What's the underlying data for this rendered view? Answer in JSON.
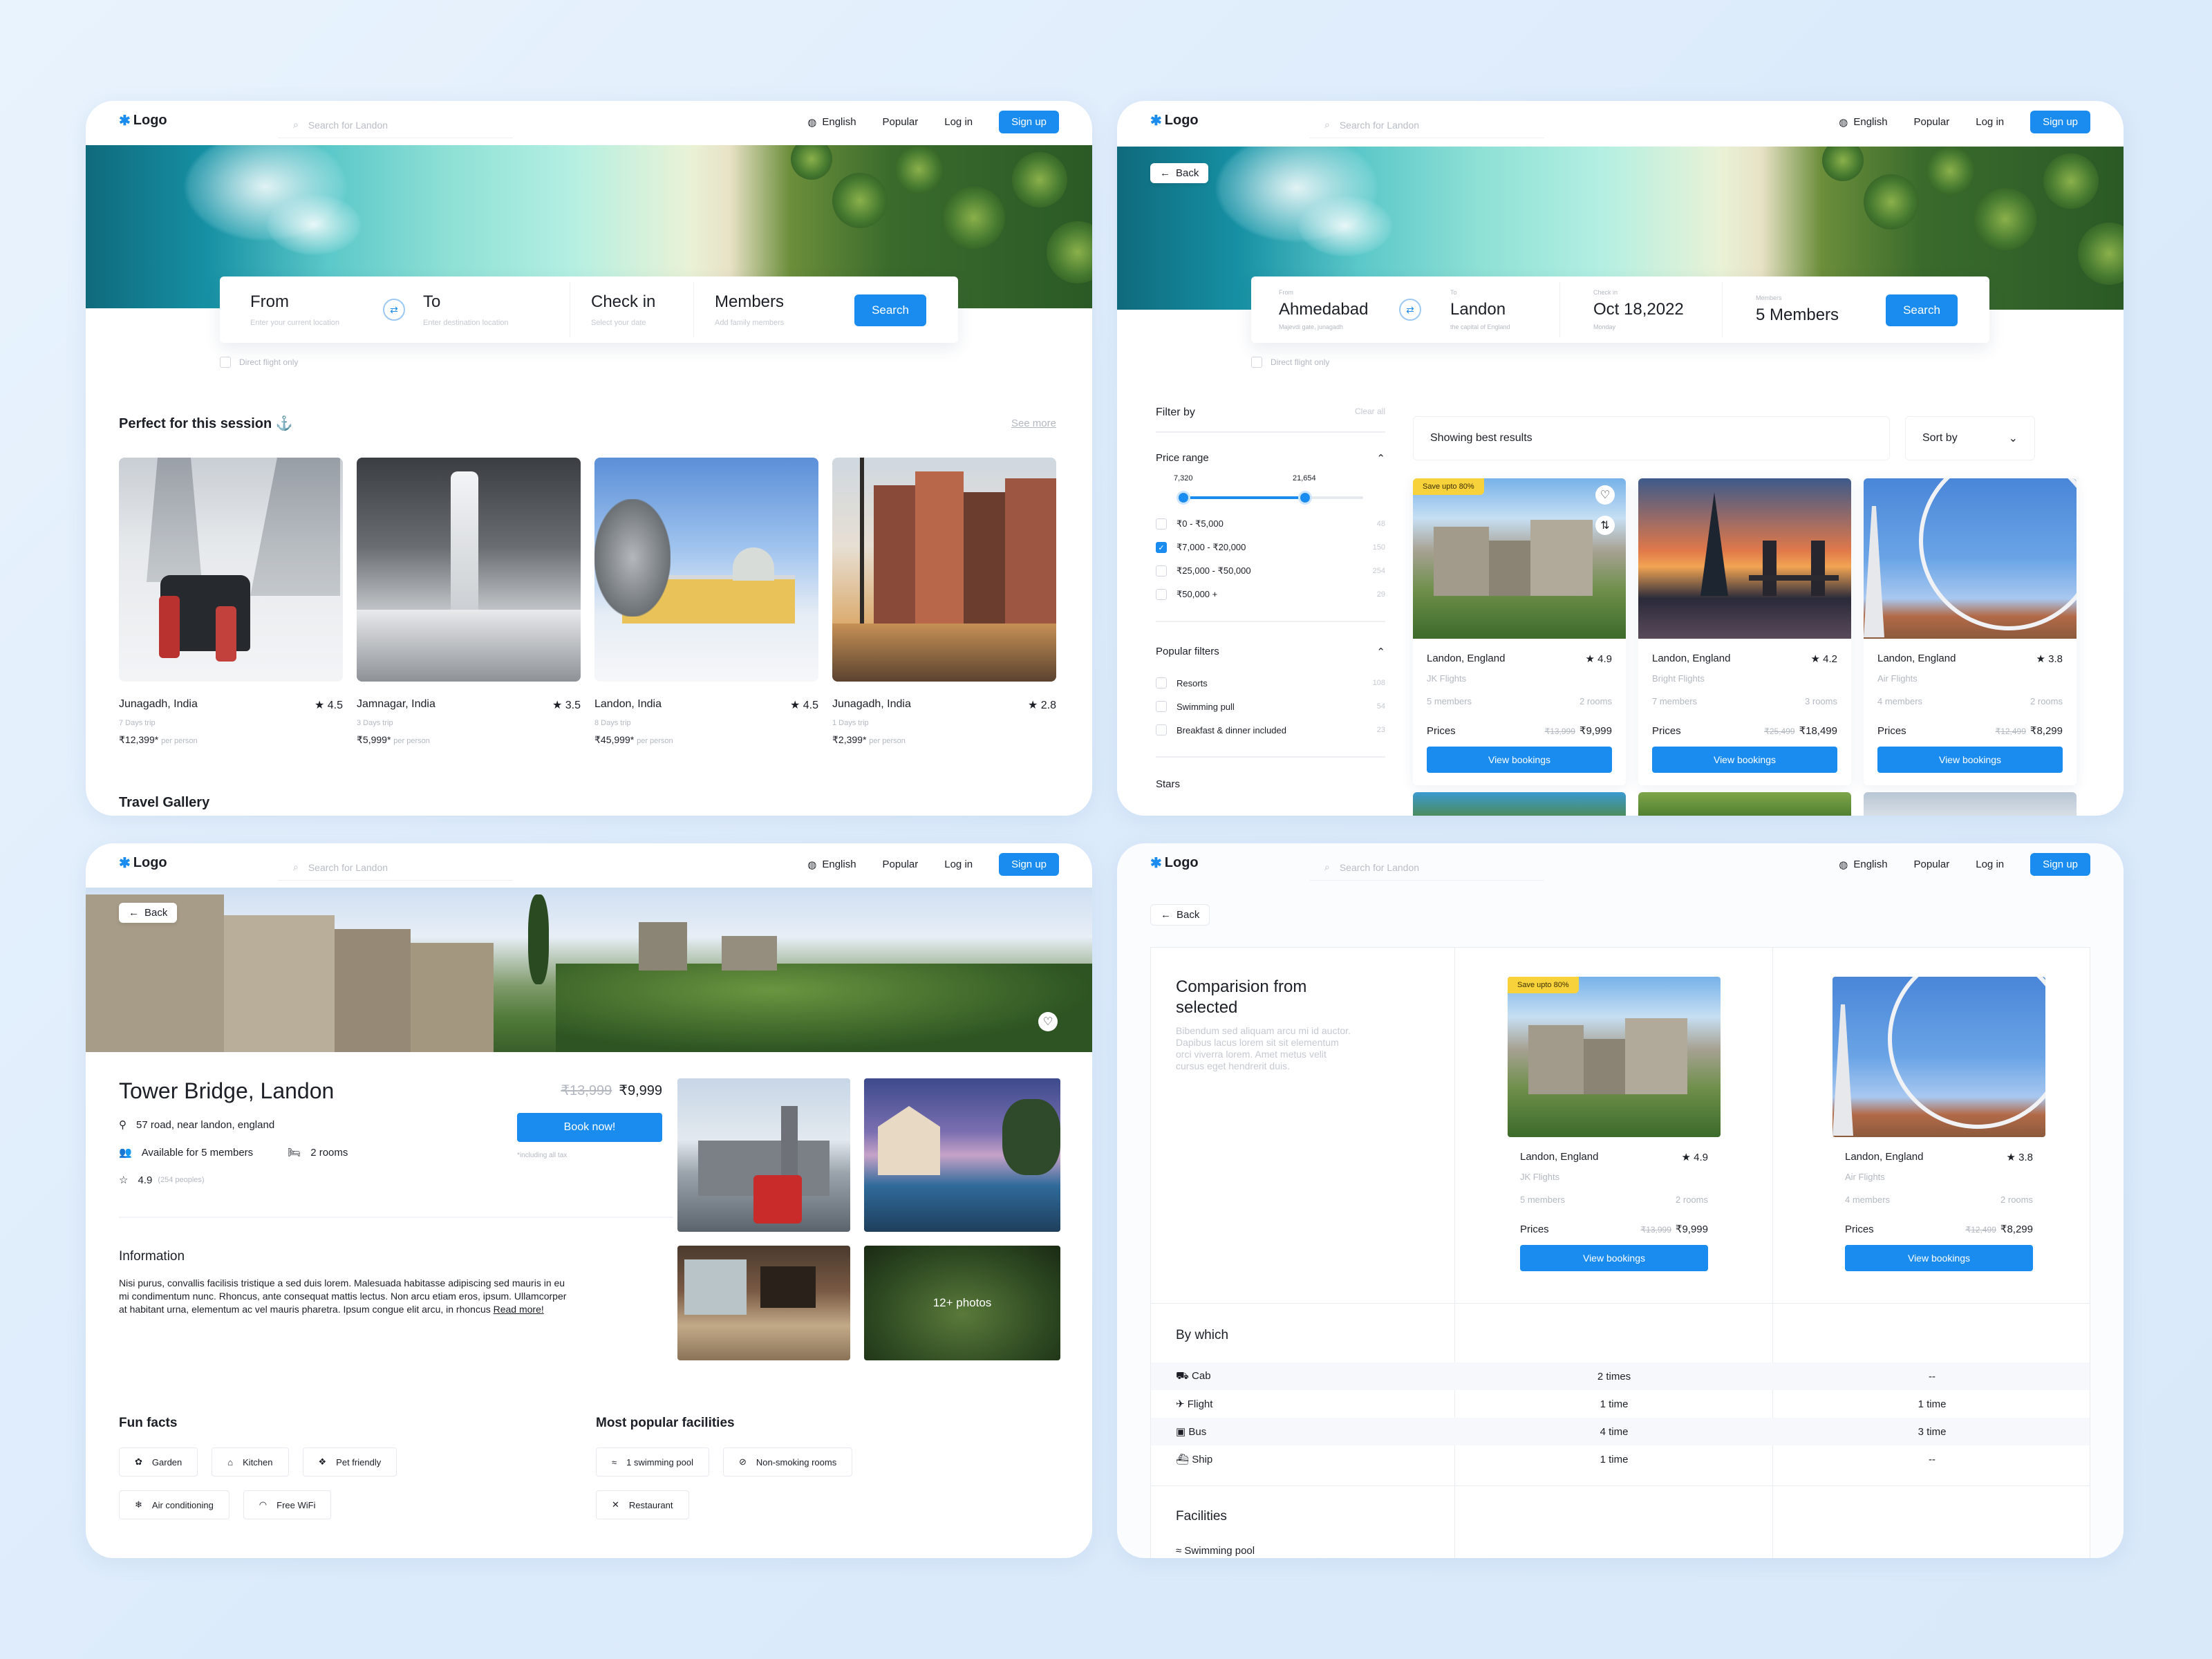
{
  "nav": {
    "logo": "Logo",
    "search_placeholder": "Search for Landon",
    "language": "English",
    "popular": "Popular",
    "login": "Log in",
    "signup": "Sign up"
  },
  "home": {
    "search": {
      "from_label": "From",
      "from_placeholder": "Enter your current location",
      "to_label": "To",
      "to_placeholder": "Enter destination location",
      "checkin_label": "Check in",
      "checkin_placeholder": "Select your date",
      "members_label": "Members",
      "members_placeholder": "Add family members",
      "search_button": "Search",
      "direct_flight": "Direct flight only"
    },
    "section_title": "Perfect for this session",
    "see_more": "See more",
    "destinations": [
      {
        "name": "Junagadh, India",
        "rating": "4.5",
        "duration": "7 Days trip",
        "price": "₹12,399*",
        "per": "per person"
      },
      {
        "name": "Jamnagar, India",
        "rating": "3.5",
        "duration": "3 Days trip",
        "price": "₹5,999*",
        "per": "per person"
      },
      {
        "name": "Landon, India",
        "rating": "4.5",
        "duration": "8 Days trip",
        "price": "₹45,999*",
        "per": "per person"
      },
      {
        "name": "Junagadh, India",
        "rating": "2.8",
        "duration": "1 Days trip",
        "price": "₹2,399*",
        "per": "per person"
      }
    ],
    "gallery_title": "Travel Gallery"
  },
  "results": {
    "back": "Back",
    "search": {
      "from_small": "From",
      "from_value": "Ahmedabad",
      "from_sub": "Majevdi gate, junagadh",
      "to_small": "To",
      "to_value": "Landon",
      "to_sub": "the capital of England",
      "checkin_small": "Check in",
      "checkin_value": "Oct 18,2022",
      "checkin_sub": "Monday",
      "members_small": "Members",
      "members_value": "5 Members",
      "search_button": "Search",
      "direct_flight": "Direct flight only"
    },
    "filter": {
      "title": "Filter by",
      "clear": "Clear all",
      "price_range": "Price range",
      "min": "7,320",
      "max": "21,654",
      "price_options": [
        {
          "label": "₹0 - ₹5,000",
          "count": "48",
          "checked": false
        },
        {
          "label": "₹7,000 - ₹20,000",
          "count": "150",
          "checked": true
        },
        {
          "label": "₹25,000 - ₹50,000",
          "count": "254",
          "checked": false
        },
        {
          "label": "₹50,000 +",
          "count": "29",
          "checked": false
        }
      ],
      "popular": "Popular filters",
      "popular_options": [
        {
          "label": "Resorts",
          "count": "108"
        },
        {
          "label": "Swimming pull",
          "count": "54"
        },
        {
          "label": "Breakfast & dinner included",
          "count": "23"
        }
      ],
      "stars": "Stars"
    },
    "showing": "Showing best results",
    "sort": "Sort by",
    "save_badge": "Save upto 80%",
    "hotels": [
      {
        "name": "Landon, England",
        "rating": "4.9",
        "airline": "JK Flights",
        "members": "5 members",
        "rooms": "2 rooms",
        "price_label": "Prices",
        "old": "₹13,999",
        "price": "₹9,999",
        "cta": "View bookings"
      },
      {
        "name": "Landon, England",
        "rating": "4.2",
        "airline": "Bright Flights",
        "members": "7 members",
        "rooms": "3 rooms",
        "price_label": "Prices",
        "old": "₹25,499",
        "price": "₹18,499",
        "cta": "View bookings"
      },
      {
        "name": "Landon, England",
        "rating": "3.8",
        "airline": "Air Flights",
        "members": "4 members",
        "rooms": "2 rooms",
        "price_label": "Prices",
        "old": "₹12,499",
        "price": "₹8,299",
        "cta": "View bookings"
      }
    ]
  },
  "detail": {
    "back": "Back",
    "title": "Tower Bridge, Landon",
    "address": "57 road, near landon, england",
    "available": "Available for 5 members",
    "rooms": "2 rooms",
    "rating": "4.9",
    "reviews": "(254 peoples)",
    "old_price": "₹13,999",
    "price": "₹9,999",
    "book": "Book now!",
    "tax": "*including all tax",
    "photos": "12+ photos",
    "info_title": "Information",
    "info_text": "Nisi purus, convallis facilisis tristique a sed duis lorem. Malesuada habitasse adipiscing sed mauris in eu mi condimentum nunc. Rhoncus, ante consequat mattis lectus. Non arcu etiam eros, ipsum. Ullamcorper at habitant urna, elementum ac vel mauris pharetra. Ipsum congue elit arcu, in rhoncus",
    "read_more": "Read more!",
    "fun_title": "Fun facts",
    "fun": [
      "Garden",
      "Kitchen",
      "Pet friendly",
      "Air conditioning",
      "Free WiFi"
    ],
    "fac_title": "Most popular facilities",
    "facilities": [
      "1 swimming pool",
      "Non-smoking rooms",
      "Restaurant"
    ]
  },
  "compare": {
    "back": "Back",
    "title1": "Comparision from",
    "title2": "selected",
    "desc": "Bibendum sed aliquam arcu mi id auctor. Dapibus lacus lorem sit sit elementum orci viverra lorem. Amet metus velit cursus eget hendrerit duis.",
    "save_badge": "Save upto 80%",
    "cards": [
      {
        "name": "Landon, England",
        "rating": "4.9",
        "airline": "JK Flights",
        "members": "5 members",
        "rooms": "2 rooms",
        "price_label": "Prices",
        "old": "₹13,999",
        "price": "₹9,999",
        "cta": "View bookings"
      },
      {
        "name": "Landon, England",
        "rating": "3.8",
        "airline": "Air Flights",
        "members": "4 members",
        "rooms": "2 rooms",
        "price_label": "Prices",
        "old": "₹12,499",
        "price": "₹8,299",
        "cta": "View bookings"
      }
    ],
    "by_which": "By which",
    "modes": [
      {
        "name": "Cab",
        "a": "2 times",
        "b": "--"
      },
      {
        "name": "Flight",
        "a": "1 time",
        "b": "1 time"
      },
      {
        "name": "Bus",
        "a": "4 time",
        "b": "3 time"
      },
      {
        "name": "Ship",
        "a": "1 time",
        "b": "--"
      }
    ],
    "facilities": "Facilities",
    "fac_first": "Swimming pool"
  }
}
